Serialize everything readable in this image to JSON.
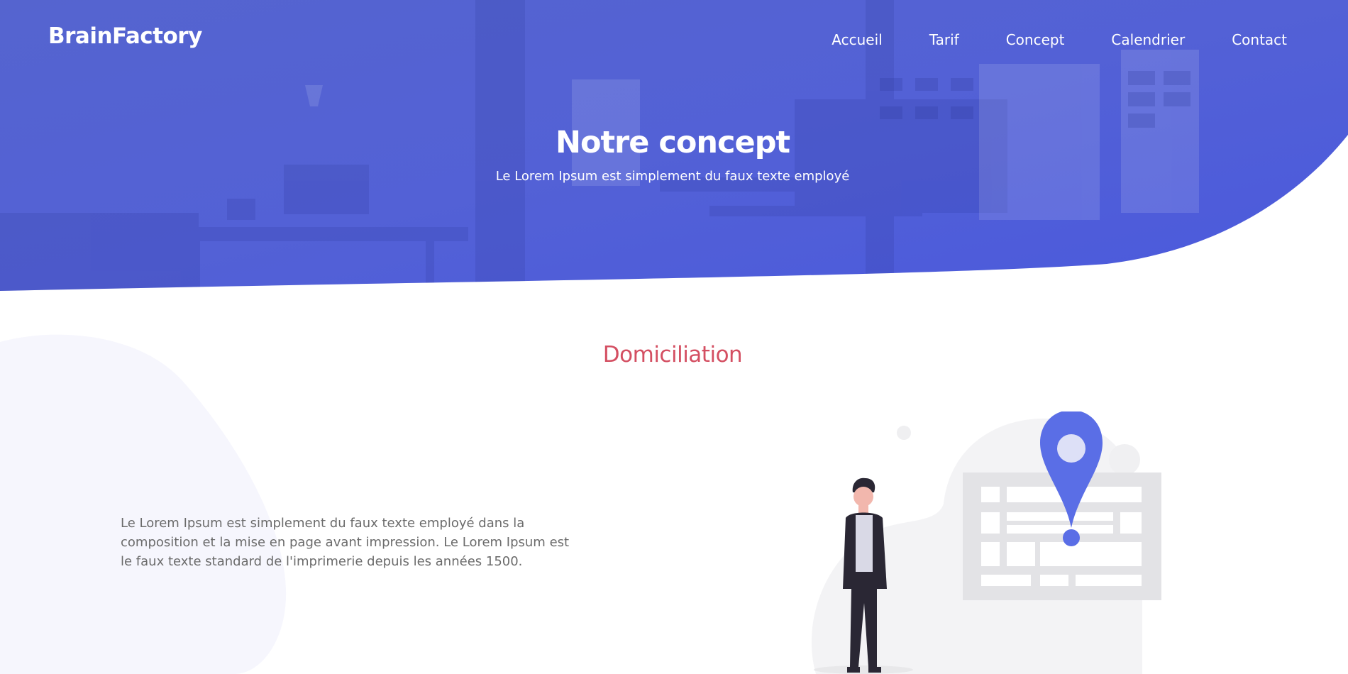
{
  "header": {
    "brand": "BrainFactory",
    "nav": [
      "Accueil",
      "Tarif",
      "Concept",
      "Calendrier",
      "Contact"
    ]
  },
  "hero": {
    "title": "Notre concept",
    "subtitle": "Le Lorem Ipsum est simplement du faux texte employé"
  },
  "section": {
    "title": "Domiciliation",
    "text": "Le Lorem Ipsum est simplement du faux texte employé dans la composition et la mise en page avant impression. Le Lorem Ipsum est le faux texte standard de l'imprimerie depuis les années 1500."
  },
  "colors": {
    "hero_blue": "#4f5ed6",
    "accent_red": "#d44f62",
    "pin_blue": "#5a6ee6",
    "text_gray": "#6b6b6b"
  }
}
